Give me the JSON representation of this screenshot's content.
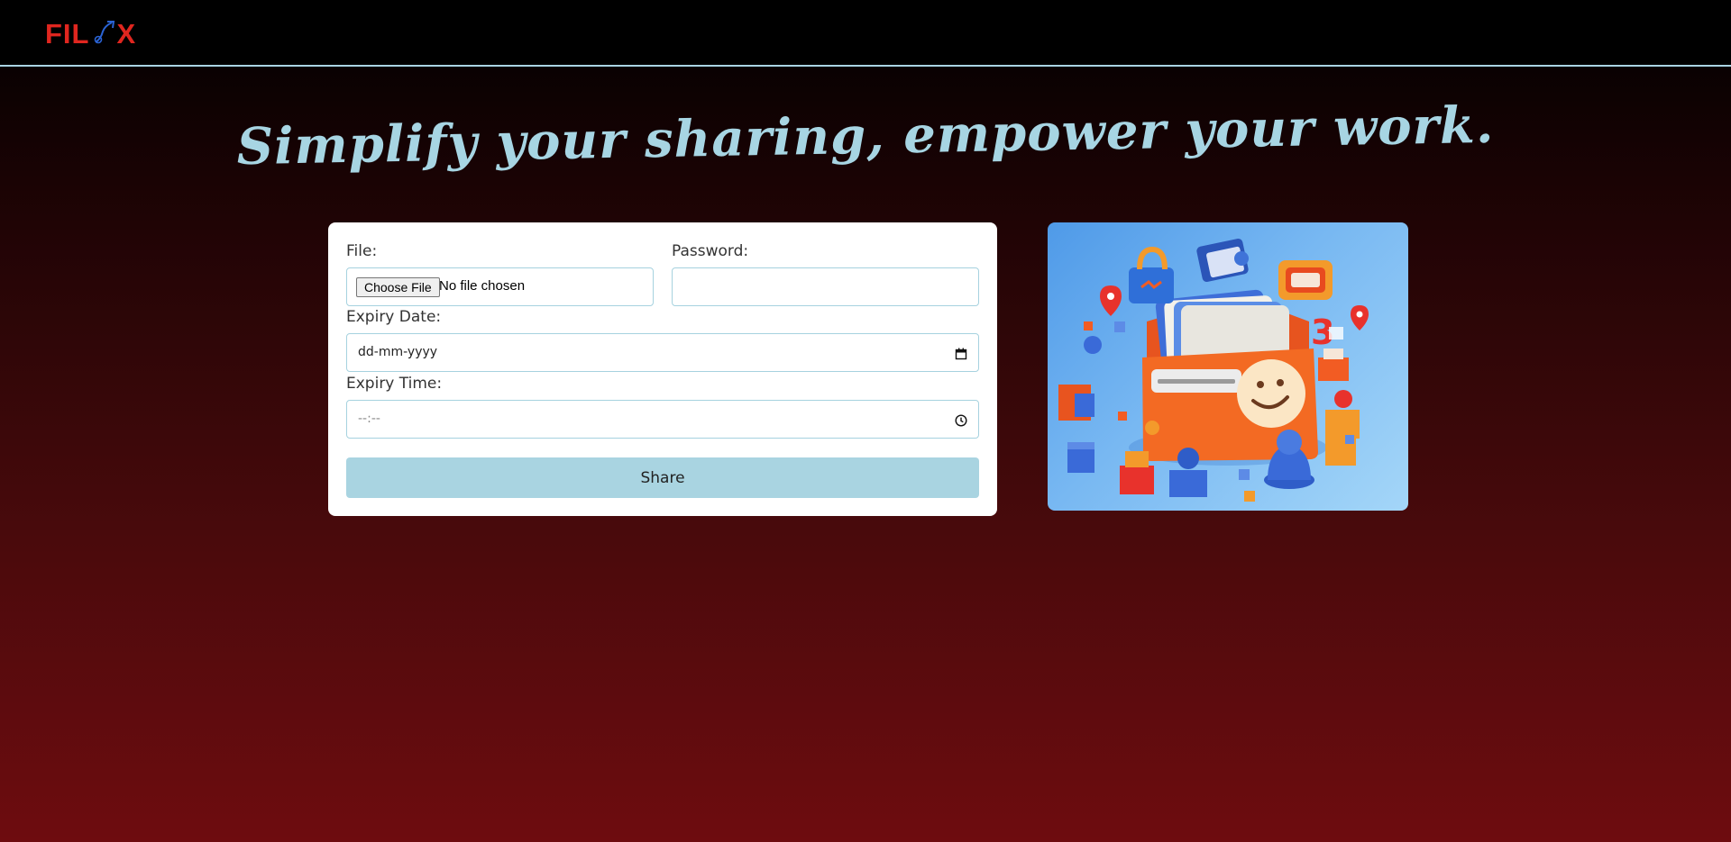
{
  "header": {
    "logo_left": "FIL",
    "logo_right": "X",
    "logo_icon": "upload-arrow-icon"
  },
  "hero": {
    "headline": "Simplify your sharing, empower your work."
  },
  "form": {
    "file_label": "File:",
    "file_button": "Choose File",
    "file_status": "No file chosen",
    "password_label": "Password:",
    "password_value": "",
    "expiry_date_label": "Expiry Date:",
    "expiry_date_placeholder": "dd-mm-yyyy",
    "expiry_time_label": "Expiry Time:",
    "expiry_time_placeholder": "--:--",
    "share_button": "Share"
  },
  "illustration": {
    "icon": "file-sharing-illustration"
  },
  "colors": {
    "accent": "#a9d4e1",
    "brand": "#e0261f",
    "headline": "#a7d5e3",
    "background_top": "#000000",
    "background_bottom": "#6e0c0f"
  }
}
